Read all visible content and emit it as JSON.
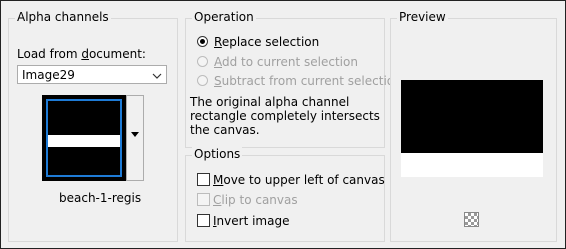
{
  "alpha_channels": {
    "group_label": "Alpha channels",
    "load_label_pre": "Load from ",
    "load_label_key": "d",
    "load_label_post": "ocument:",
    "source_value": "Image29",
    "channel_name": "beach-1-regis"
  },
  "operation": {
    "group_label": "Operation",
    "options": [
      {
        "key": "R",
        "rest": "eplace selection",
        "selected": true,
        "enabled": true
      },
      {
        "key": "A",
        "rest": "dd to current selection",
        "selected": false,
        "enabled": false
      },
      {
        "key": "S",
        "rest": "ubtract from current selection",
        "selected": false,
        "enabled": false
      }
    ],
    "description": "The original alpha channel rectangle completely intersects the canvas."
  },
  "options": {
    "group_label": "Options",
    "items": [
      {
        "key": "M",
        "rest": "ove to upper left of canvas",
        "checked": false,
        "enabled": true
      },
      {
        "key": "C",
        "rest": "lip to canvas",
        "checked": false,
        "enabled": false
      },
      {
        "key": "I",
        "rest": "nvert image",
        "checked": false,
        "enabled": true
      }
    ]
  },
  "preview": {
    "group_label": "Preview",
    "toggle_icon": "transparency-checker-icon"
  }
}
